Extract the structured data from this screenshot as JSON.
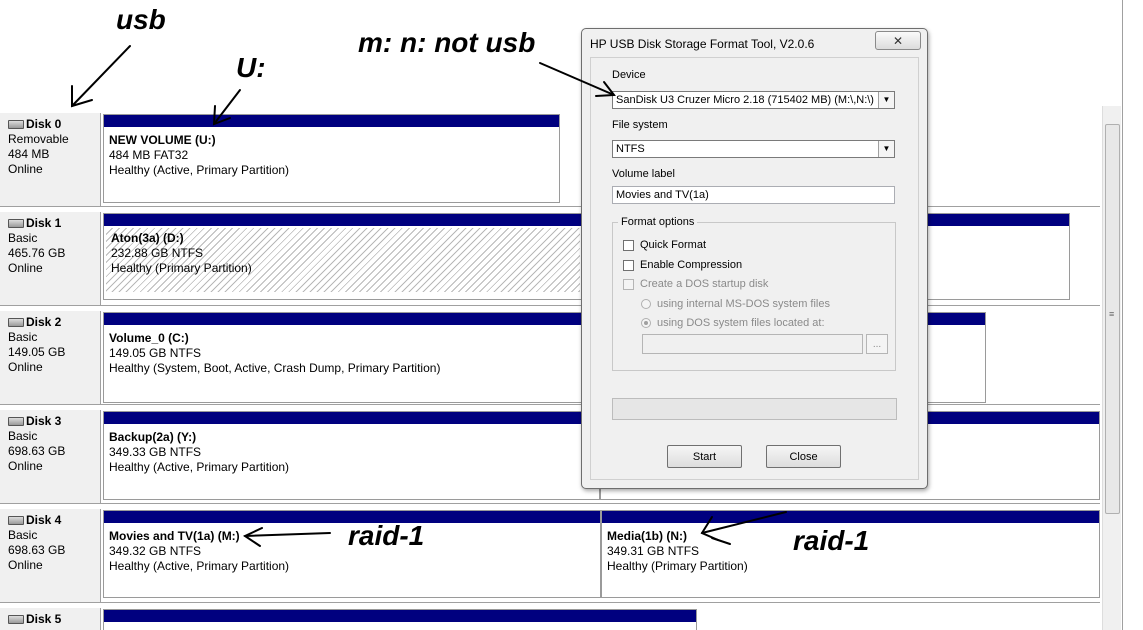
{
  "annotations": {
    "usb": "usb",
    "u": "U:",
    "not_usb": "m: n: not usb",
    "raid_left": "raid-1",
    "raid_right": "raid-1"
  },
  "disks": [
    {
      "name": "Disk 0",
      "type": "Removable",
      "size": "484 MB",
      "status": "Online"
    },
    {
      "name": "Disk 1",
      "type": "Basic",
      "size": "465.76 GB",
      "status": "Online"
    },
    {
      "name": "Disk 2",
      "type": "Basic",
      "size": "149.05 GB",
      "status": "Online"
    },
    {
      "name": "Disk 3",
      "type": "Basic",
      "size": "698.63 GB",
      "status": "Online"
    },
    {
      "name": "Disk 4",
      "type": "Basic",
      "size": "698.63 GB",
      "status": "Online"
    },
    {
      "name": "Disk 5"
    }
  ],
  "partitions": {
    "d0": {
      "title": "NEW VOLUME  (U:)",
      "size": "484 MB FAT32",
      "status": "Healthy (Active, Primary Partition)"
    },
    "d1": {
      "title": "Aton(3a)  (D:)",
      "size": "232.88 GB NTFS",
      "status": "Healthy (Primary Partition)"
    },
    "d2": {
      "title": "Volume_0  (C:)",
      "size": "149.05 GB NTFS",
      "status": "Healthy (System, Boot, Active, Crash Dump, Primary Partition)"
    },
    "d3": {
      "title": "Backup(2a)  (Y:)",
      "size": "349.33 GB NTFS",
      "status": "Healthy (Active, Primary Partition)"
    },
    "d4a": {
      "title": "Movies and TV(1a)  (M:)",
      "size": "349.32 GB NTFS",
      "status": "Healthy (Active, Primary Partition)"
    },
    "d4b": {
      "title": "Media(1b)  (N:)",
      "size": "349.31 GB NTFS",
      "status": "Healthy (Primary Partition)"
    }
  },
  "dialog": {
    "title": "HP USB Disk Storage Format Tool, V2.0.6",
    "device_label": "Device",
    "device_value": "SanDisk U3 Cruzer Micro 2.18 (715402 MB) (M:\\,N:\\)",
    "fs_label": "File system",
    "fs_value": "NTFS",
    "vol_label": "Volume label",
    "vol_value": "Movies and TV(1a)",
    "format_options": "Format options",
    "quick_format": "Quick Format",
    "enable_compression": "Enable Compression",
    "create_dos": "Create a DOS startup disk",
    "internal_dos": "using internal MS-DOS system files",
    "dos_located": "using DOS system files located at:",
    "browse": "...",
    "start": "Start",
    "close": "Close"
  }
}
